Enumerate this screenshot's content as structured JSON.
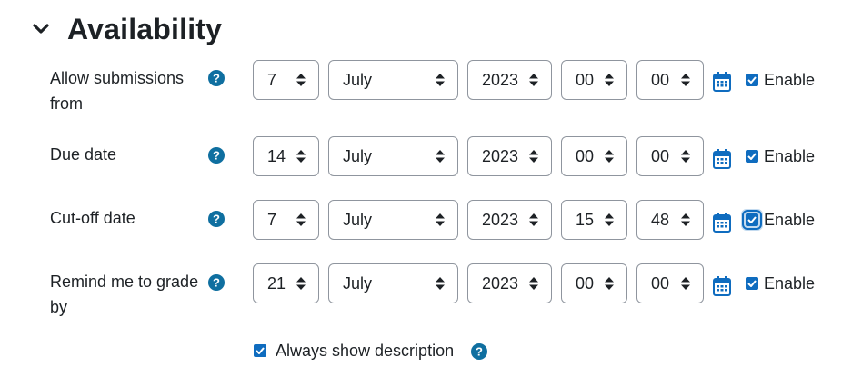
{
  "section": {
    "title": "Availability",
    "icon": "chevron-down-icon"
  },
  "rows": [
    {
      "label": "Allow submissions from",
      "day": "7",
      "month": "July",
      "year": "2023",
      "hour": "00",
      "minute": "00",
      "enable_label": "Enable",
      "enabled": true
    },
    {
      "label": "Due date",
      "day": "14",
      "month": "July",
      "year": "2023",
      "hour": "00",
      "minute": "00",
      "enable_label": "Enable",
      "enabled": true
    },
    {
      "label": "Cut-off date",
      "day": "7",
      "month": "July",
      "year": "2023",
      "hour": "15",
      "minute": "48",
      "enable_label": "Enable",
      "enabled": true
    },
    {
      "label": "Remind me to grade by",
      "day": "21",
      "month": "July",
      "year": "2023",
      "hour": "00",
      "minute": "00",
      "enable_label": "Enable",
      "enabled": true
    }
  ],
  "always_show_description": {
    "label": "Always show description",
    "checked": true
  },
  "colors": {
    "accent": "#0f6cbf",
    "help": "#0f6fa0",
    "text": "#1d2125",
    "border": "#8f959e"
  }
}
